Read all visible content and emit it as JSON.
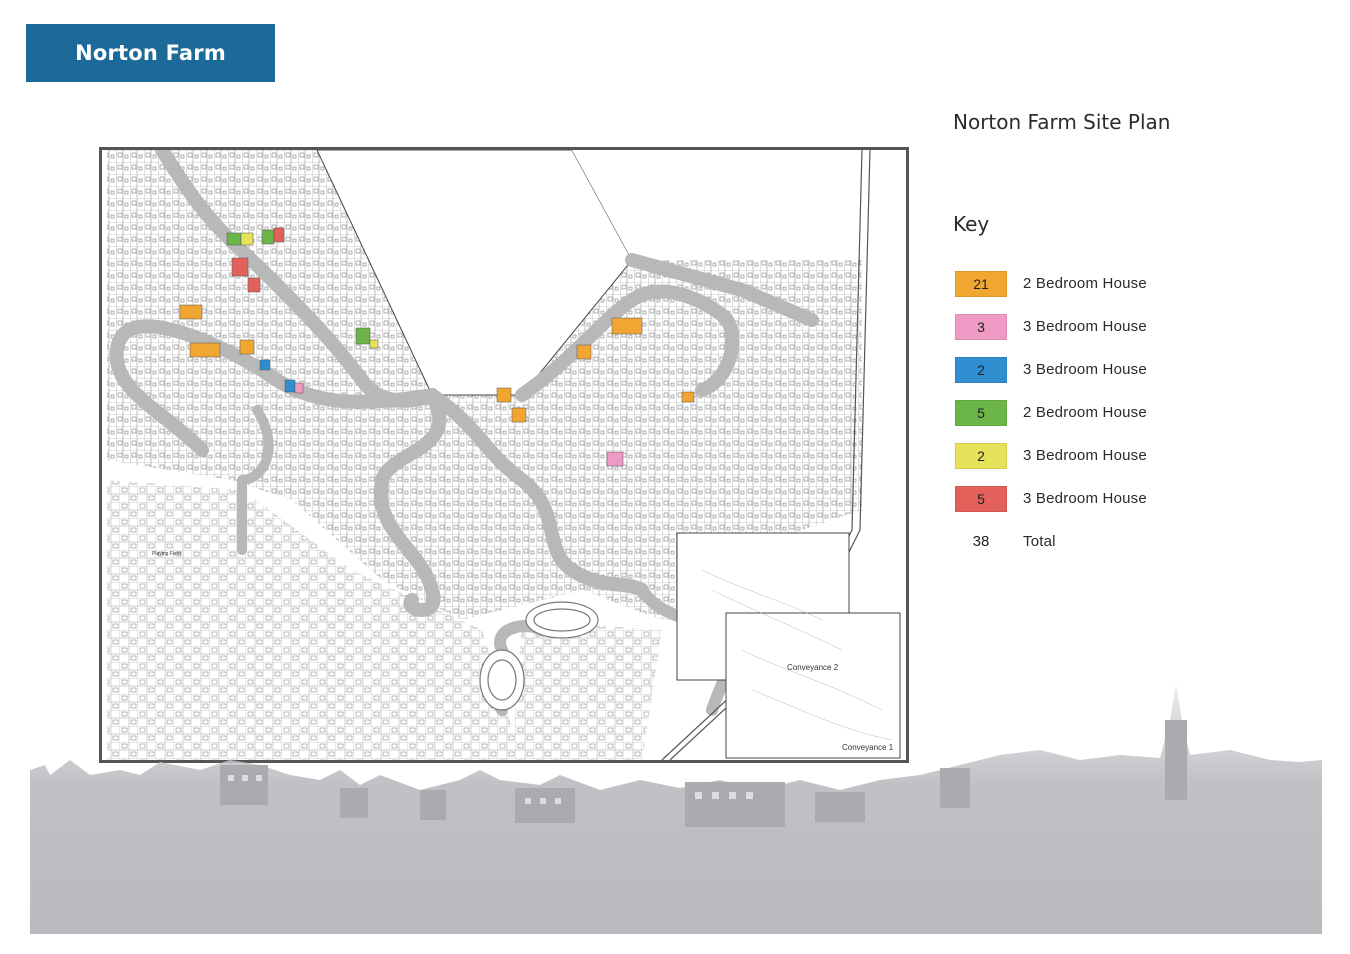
{
  "header": {
    "banner": "Norton Farm"
  },
  "plan": {
    "title": "Norton Farm Site Plan"
  },
  "key": {
    "title": "Key",
    "items": [
      {
        "count": "21",
        "label": "2 Bedroom House",
        "color": "#f0a630"
      },
      {
        "count": "3",
        "label": "3 Bedroom House",
        "color": "#ef9ac4"
      },
      {
        "count": "2",
        "label": "3 Bedroom House",
        "color": "#2f8ed0"
      },
      {
        "count": "5",
        "label": "2 Bedroom House",
        "color": "#6cb548"
      },
      {
        "count": "2",
        "label": "3 Bedroom House",
        "color": "#e6e35a"
      },
      {
        "count": "5",
        "label": "3 Bedroom House",
        "color": "#e2625b"
      }
    ],
    "total": {
      "count": "38",
      "label": "Total"
    }
  },
  "map": {
    "labels": {
      "playing_field": "Playing Field",
      "conveyance_1": "Conveyance 1",
      "conveyance_2": "Conveyance 2"
    }
  }
}
